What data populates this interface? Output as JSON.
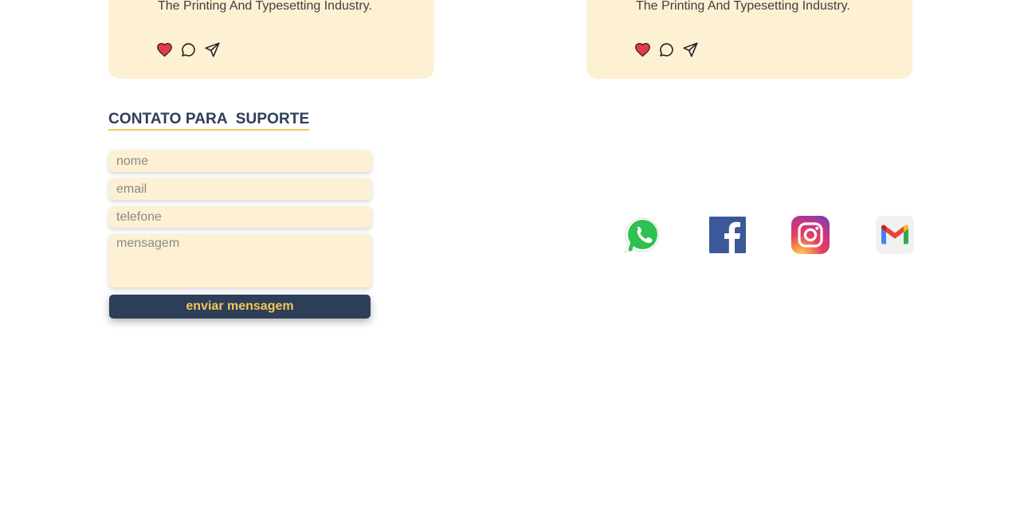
{
  "cards": [
    {
      "text": "The Printing And Typesetting Industry.",
      "actions": [
        "heart-icon",
        "comment-icon",
        "send-icon"
      ]
    },
    {
      "text": "The Printing And Typesetting Industry.",
      "actions": [
        "heart-icon",
        "comment-icon",
        "send-icon"
      ]
    }
  ],
  "support": {
    "title": "CONTATO PARA  SUPORTE",
    "fields": {
      "name_placeholder": "nome",
      "email_placeholder": "email",
      "phone_placeholder": "telefone",
      "message_placeholder": "mensagem"
    },
    "submit_label": "enviar mensagem"
  },
  "social_links": [
    "whatsapp-icon",
    "facebook-icon",
    "instagram-icon",
    "gmail-icon"
  ],
  "colors": {
    "card_bg": "#fdf0d3",
    "navy": "#2d3e58",
    "accent_yellow": "#f2c75c",
    "heart_red": "#e63946"
  }
}
